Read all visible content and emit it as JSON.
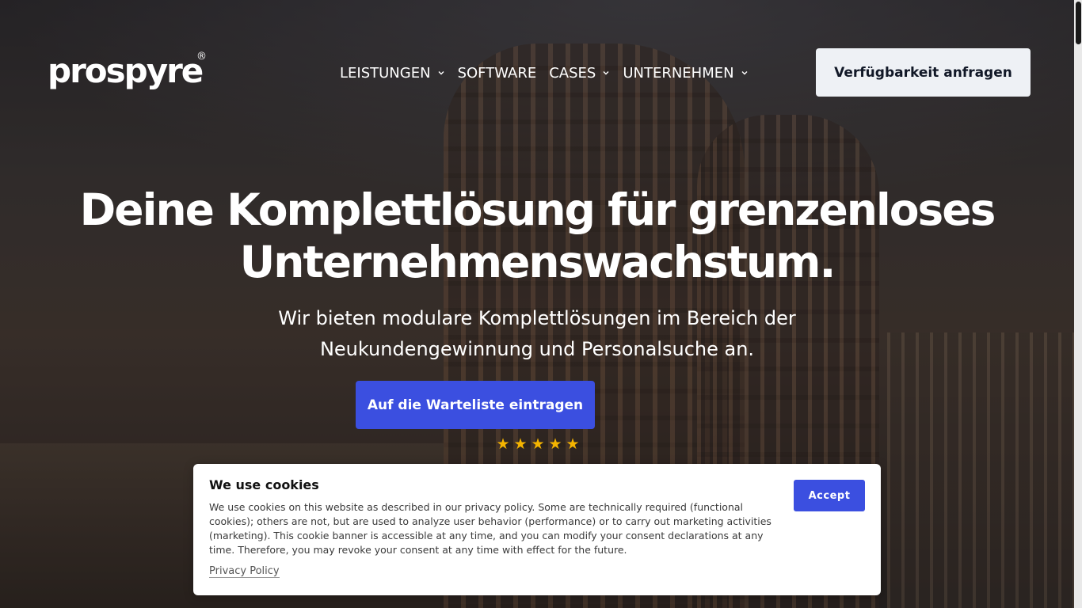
{
  "brand": {
    "logo_text": "prospyre",
    "registered_mark": "®"
  },
  "nav": {
    "items": [
      {
        "label": "LEISTUNGEN",
        "has_dropdown": true
      },
      {
        "label": "SOFTWARE",
        "has_dropdown": false
      },
      {
        "label": "CASES",
        "has_dropdown": true
      },
      {
        "label": "UNTERNEHMEN",
        "has_dropdown": true
      }
    ],
    "cta_label": "Verfügbarkeit anfragen"
  },
  "hero": {
    "headline_line1": "Deine Komplettlösung für grenzenloses",
    "headline_line2": "Unternehmenswachstum.",
    "subline_line1": "Wir bieten modulare Komplettlösungen im Bereich der",
    "subline_line2": "Neukundengewinnung und Personalsuche an.",
    "cta_label": "Auf die Warteliste eintragen",
    "rating_stars": 5
  },
  "cookie_banner": {
    "title": "We use cookies",
    "body": "We use cookies on this website as described in our privacy policy. Some are technically required (functional cookies); others are not, but are used to analyze user behavior (performance) or to carry out marketing activities (marketing). This cookie banner is accessible at any time, and you can modify your consent declarations at any time. Therefore, you may revoke your consent at any time with effect for the future.",
    "privacy_link": "Privacy Policy",
    "accept_label": "Accept"
  },
  "colors": {
    "accent": "#3b4fe0",
    "star": "#f4b400",
    "top_cta_bg": "#eef1f5"
  },
  "icons": {
    "dropdown": "chevron-down-icon",
    "rating": "star-icon"
  }
}
